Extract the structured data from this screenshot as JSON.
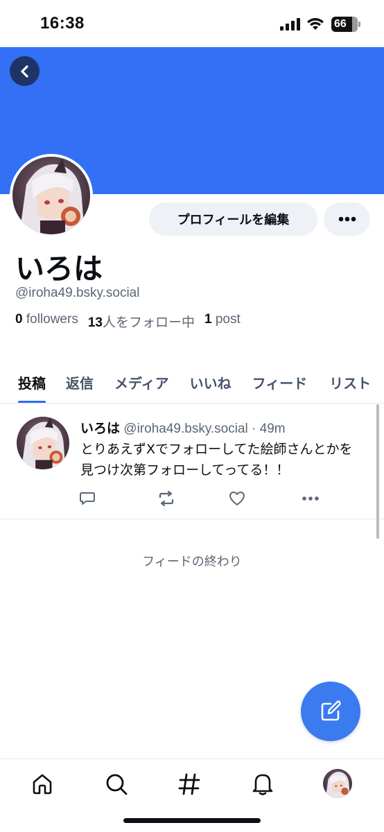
{
  "status_bar": {
    "time": "16:38",
    "battery": "66"
  },
  "profile": {
    "banner_color": "#3370f5",
    "display_name": "いろは",
    "handle": "@iroha49.bsky.social",
    "edit_button": "プロフィールを編集",
    "stats": {
      "followers_count": "0",
      "followers_label": "followers",
      "following_count": "13",
      "following_label": "人をフォロー中",
      "posts_count": "1",
      "posts_label": "post"
    }
  },
  "tabs": [
    {
      "label": "投稿",
      "active": true
    },
    {
      "label": "返信"
    },
    {
      "label": "メディア"
    },
    {
      "label": "いいね"
    },
    {
      "label": "フィード"
    },
    {
      "label": "リスト"
    }
  ],
  "post": {
    "author_name": "いろは",
    "author_handle": "@iroha49.bsky.social",
    "separator": "·",
    "time_ago": "49m",
    "text": "とりあえずXでフォローしてた絵師さんとかを見つけ次第フォローしてってる！！"
  },
  "feed_end_text": "フィードの終わり",
  "icons": {
    "back": "chevron-left-icon",
    "more": "ellipsis-icon",
    "reply": "speech-bubble-icon",
    "repost": "repost-icon",
    "like": "heart-icon",
    "compose": "compose-icon",
    "home": "home-icon",
    "search": "search-icon",
    "feeds": "hashtag-icon",
    "notifications": "bell-icon"
  },
  "colors": {
    "accent": "#2b6ef6",
    "fab": "#3b7bf0",
    "muted": "#5b6673"
  }
}
